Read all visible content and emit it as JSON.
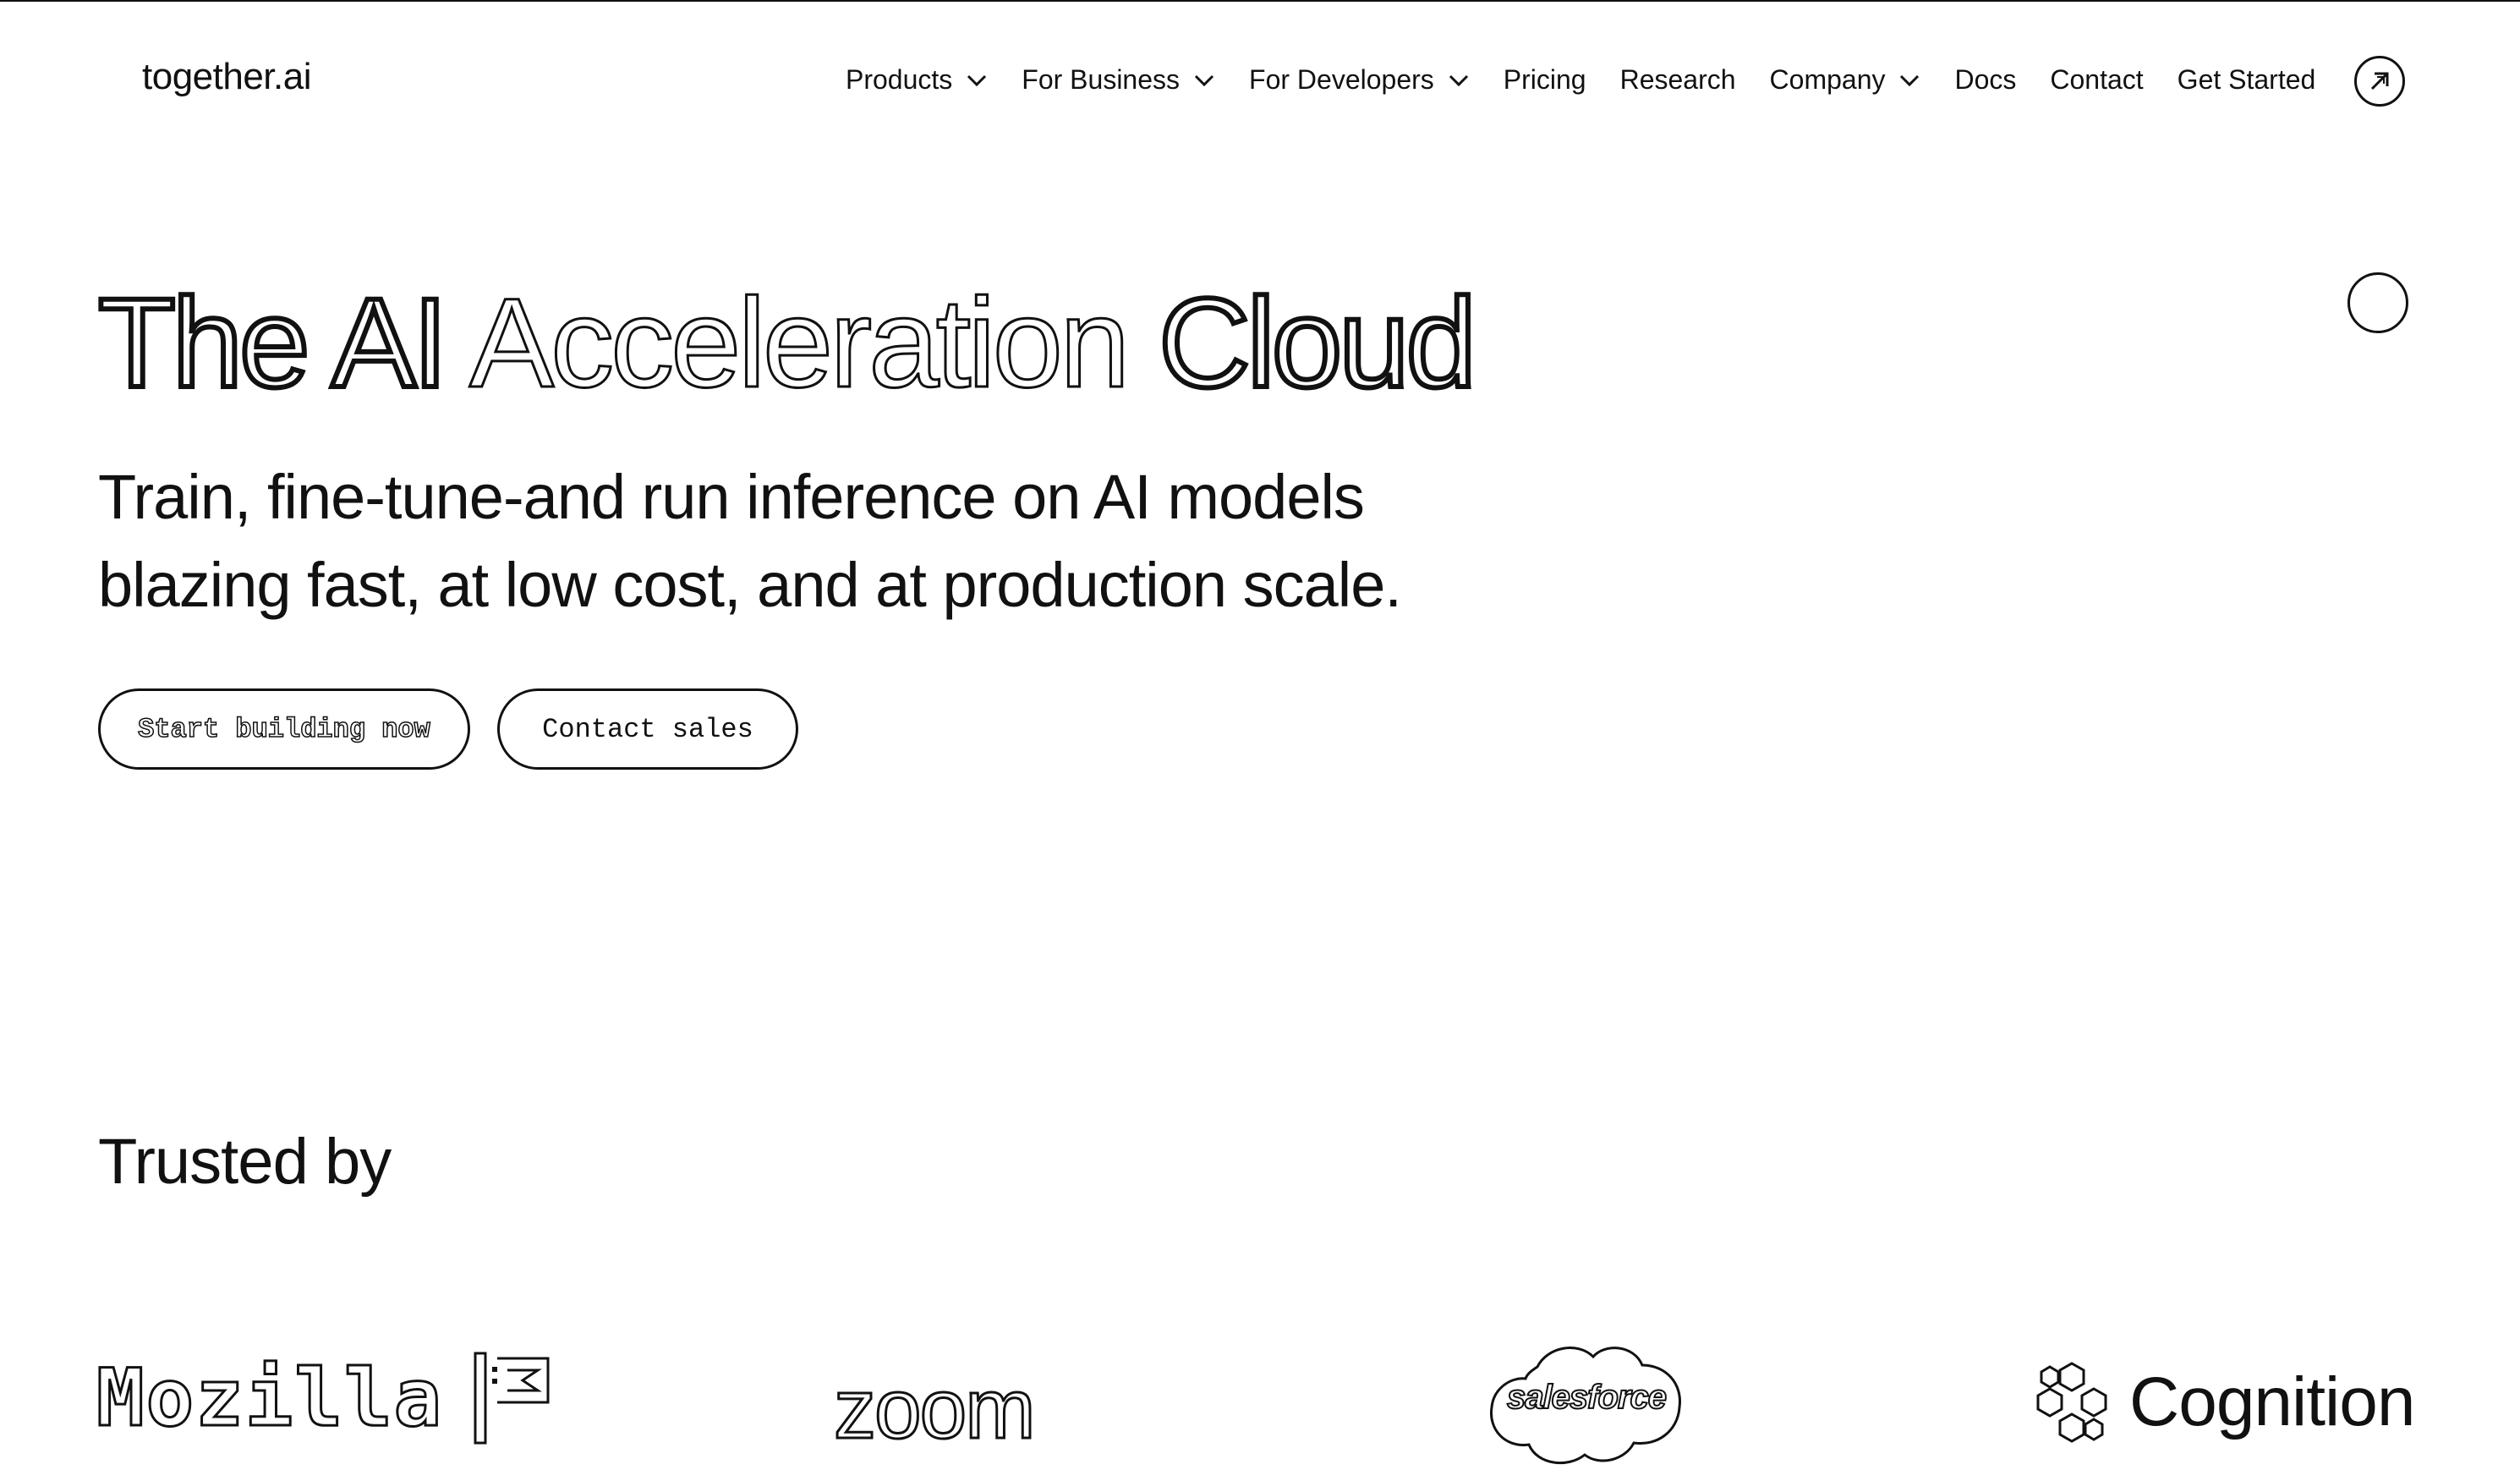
{
  "brand": {
    "logo_text": "together.ai"
  },
  "nav": {
    "items": [
      {
        "label": "Products",
        "has_dropdown": true
      },
      {
        "label": "For Business",
        "has_dropdown": true
      },
      {
        "label": "For Developers",
        "has_dropdown": true
      },
      {
        "label": "Pricing",
        "has_dropdown": false
      },
      {
        "label": "Research",
        "has_dropdown": false
      },
      {
        "label": "Company",
        "has_dropdown": true
      },
      {
        "label": "Docs",
        "has_dropdown": false
      },
      {
        "label": "Contact",
        "has_dropdown": false
      },
      {
        "label": "Get Started",
        "has_dropdown": false
      }
    ],
    "action_icon": "arrow-up-right-circle-icon"
  },
  "hero": {
    "title_parts": [
      "The AI",
      "Acceleration",
      "Cloud"
    ],
    "subtitle_line1": "Train, fine-tune-and run inference on AI models",
    "subtitle_line2": "blazing fast, at low cost, and at production scale.",
    "primary_cta": "Start building now",
    "secondary_cta": "Contact sales"
  },
  "trusted": {
    "heading": "Trusted by",
    "logos": [
      {
        "name": "Mozilla",
        "text": "Mozilla"
      },
      {
        "name": "Zoom",
        "text": "zoom"
      },
      {
        "name": "Salesforce",
        "text": "salesforce"
      },
      {
        "name": "Cognition",
        "text": "Cognition"
      }
    ]
  },
  "colors": {
    "foreground": "#111111",
    "background": "#ffffff"
  }
}
